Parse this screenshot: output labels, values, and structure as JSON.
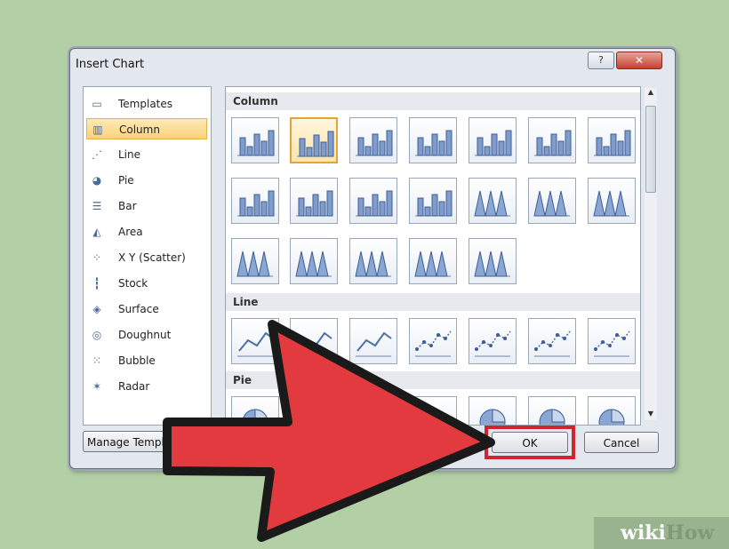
{
  "dialog": {
    "title": "Insert Chart",
    "help_glyph": "?",
    "close_glyph": "✕"
  },
  "sidebar": {
    "items": [
      {
        "label": "Templates",
        "icon": "folder-icon"
      },
      {
        "label": "Column",
        "icon": "column-chart-icon"
      },
      {
        "label": "Line",
        "icon": "line-chart-icon"
      },
      {
        "label": "Pie",
        "icon": "pie-chart-icon"
      },
      {
        "label": "Bar",
        "icon": "bar-chart-icon"
      },
      {
        "label": "Area",
        "icon": "area-chart-icon"
      },
      {
        "label": "X Y (Scatter)",
        "icon": "scatter-chart-icon"
      },
      {
        "label": "Stock",
        "icon": "stock-chart-icon"
      },
      {
        "label": "Surface",
        "icon": "surface-chart-icon"
      },
      {
        "label": "Doughnut",
        "icon": "doughnut-chart-icon"
      },
      {
        "label": "Bubble",
        "icon": "bubble-chart-icon"
      },
      {
        "label": "Radar",
        "icon": "radar-chart-icon"
      }
    ],
    "selected": "Column"
  },
  "gallery": {
    "sections": [
      {
        "title": "Column"
      },
      {
        "title": "Line"
      },
      {
        "title": "Pie"
      }
    ]
  },
  "buttons": {
    "manage_templates": "Manage Templa",
    "ok": "OK",
    "cancel": "Cancel"
  },
  "colors": {
    "background": "#b3cfa6",
    "highlight_box": "#d0242e",
    "arrow": "#e33a3f",
    "selection": "#fbd27a"
  },
  "watermark": {
    "part1": "wiki",
    "part2": "How"
  }
}
